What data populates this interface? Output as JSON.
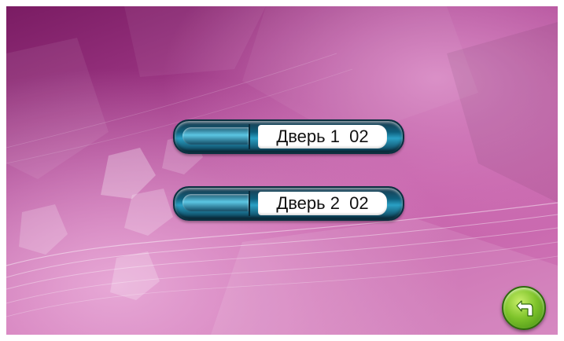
{
  "screen": {
    "background_color": "#b44a98"
  },
  "doors": [
    {
      "label": "Дверь 1  02"
    },
    {
      "label": "Дверь 2  02"
    }
  ],
  "back_button": {
    "icon": "return-arrow-icon",
    "color": "#7fc42b"
  }
}
